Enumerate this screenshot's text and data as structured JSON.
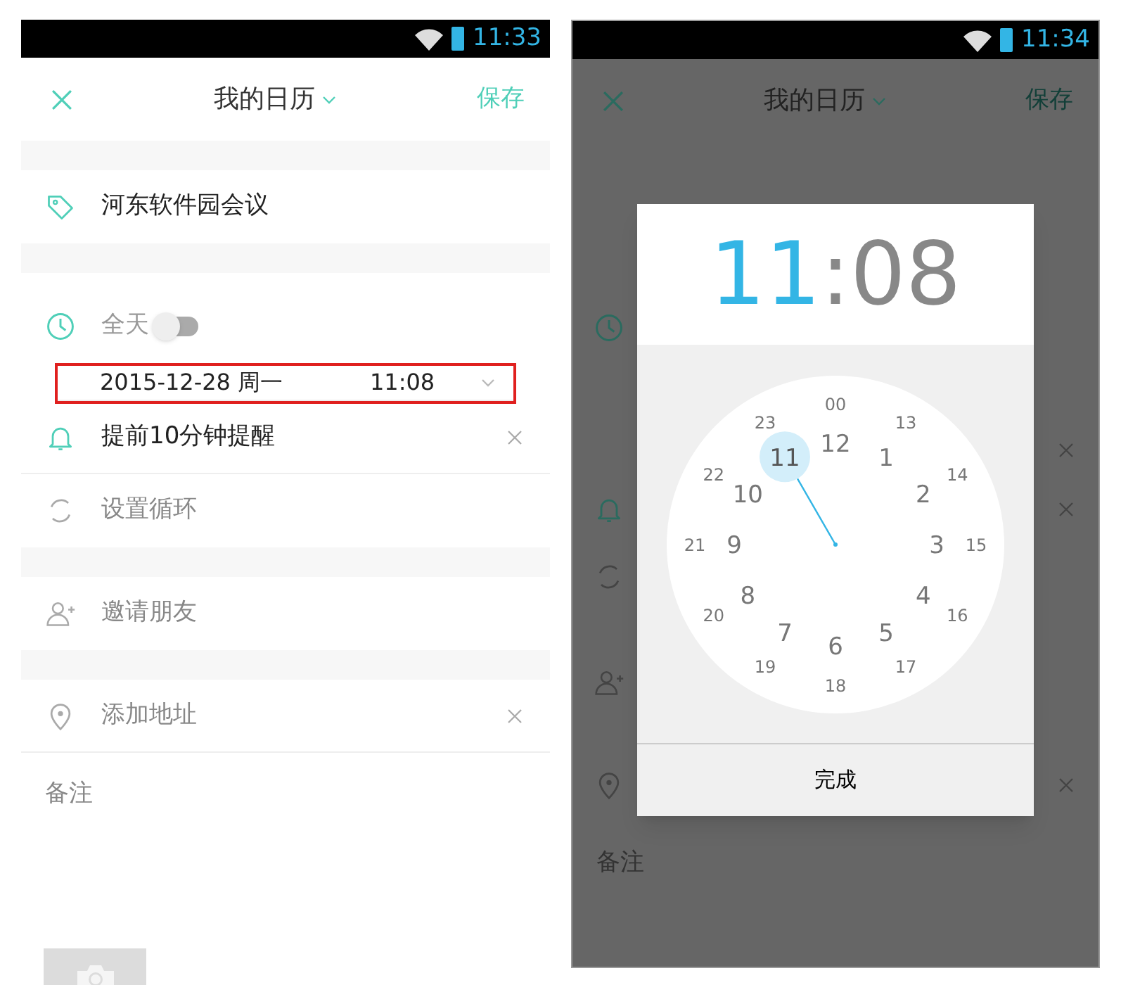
{
  "left_screen": {
    "status_bar": {
      "time": "11:33"
    },
    "header": {
      "title": "我的日历",
      "save": "保存"
    },
    "event_title": "河东软件园会议",
    "all_day": {
      "label": "全天",
      "on": false
    },
    "start": {
      "date": "2015-12-28 周一",
      "time": "11:08",
      "highlighted": true
    },
    "sections": [
      [
        {
          "kind": "reminder",
          "label": "提前10分钟提醒",
          "clearable": true
        },
        {
          "kind": "repeat",
          "label": "设置循环",
          "clearable": false
        }
      ],
      [
        {
          "kind": "invite",
          "label": "邀请朋友",
          "clearable": false
        }
      ],
      [
        {
          "kind": "location",
          "label": "添加地址",
          "clearable": true
        }
      ]
    ],
    "notes_label": "备注"
  },
  "right_screen": {
    "status_bar": {
      "time": "11:34"
    },
    "header": {
      "title": "我的日历",
      "save": "保存"
    },
    "rows": [
      {
        "kind": "clock",
        "clearable": false
      },
      {
        "kind": "blank",
        "clearable": true
      },
      {
        "kind": "reminder",
        "clearable": true
      },
      {
        "kind": "repeat",
        "clearable": false
      },
      {
        "kind": "invite",
        "clearable": false
      },
      {
        "kind": "location",
        "clearable": true
      }
    ],
    "notes_label": "备注",
    "time_picker": {
      "hour": {
        "text": "11",
        "selected": true
      },
      "separator": ":",
      "minute": {
        "text": "08",
        "selected": false
      },
      "inner_ring": [
        {
          "label": "12",
          "selected": false
        },
        {
          "label": "1",
          "selected": false
        },
        {
          "label": "2",
          "selected": false
        },
        {
          "label": "3",
          "selected": false
        },
        {
          "label": "4",
          "selected": false
        },
        {
          "label": "5",
          "selected": false
        },
        {
          "label": "6",
          "selected": false
        },
        {
          "label": "7",
          "selected": false
        },
        {
          "label": "8",
          "selected": false
        },
        {
          "label": "9",
          "selected": false
        },
        {
          "label": "10",
          "selected": false
        },
        {
          "label": "11",
          "selected": true
        }
      ],
      "outer_ring": [
        {
          "label": "00",
          "selected": false
        },
        {
          "label": "13",
          "selected": false
        },
        {
          "label": "14",
          "selected": false
        },
        {
          "label": "15",
          "selected": false
        },
        {
          "label": "16",
          "selected": false
        },
        {
          "label": "17",
          "selected": false
        },
        {
          "label": "18",
          "selected": false
        },
        {
          "label": "19",
          "selected": false
        },
        {
          "label": "20",
          "selected": false
        },
        {
          "label": "21",
          "selected": false
        },
        {
          "label": "22",
          "selected": false
        },
        {
          "label": "23",
          "selected": false
        }
      ],
      "done": "完成"
    }
  }
}
